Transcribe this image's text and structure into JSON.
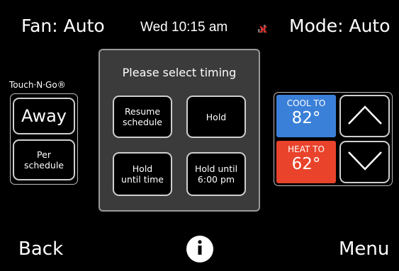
{
  "status_bar": {
    "fan": "Fan: Auto",
    "day_time": "Wed 10:15 am",
    "mode": "Mode: Auto",
    "wifi_icon": "wifi-disconnected-icon"
  },
  "left": {
    "brand": "Touch·N·Go®",
    "away_label": "Away",
    "per_schedule_label": "Per schedule"
  },
  "modal": {
    "title": "Please select timing",
    "resume_label": "Resume schedule",
    "hold_label": "Hold",
    "hold_until_time_label": "Hold until time",
    "hold_until_600_label": "Hold until 6:00 pm"
  },
  "setpoints": {
    "cool_label": "COOL TO",
    "cool_value": "82°",
    "cool_color": "#3b80d8",
    "heat_label": "HEAT TO",
    "heat_value": "62°",
    "heat_color": "#e9432b",
    "up_icon": "chevron-up-icon",
    "down_icon": "chevron-down-icon"
  },
  "bottom_bar": {
    "back_label": "Back",
    "info_icon": "info-icon",
    "menu_label": "Menu"
  }
}
